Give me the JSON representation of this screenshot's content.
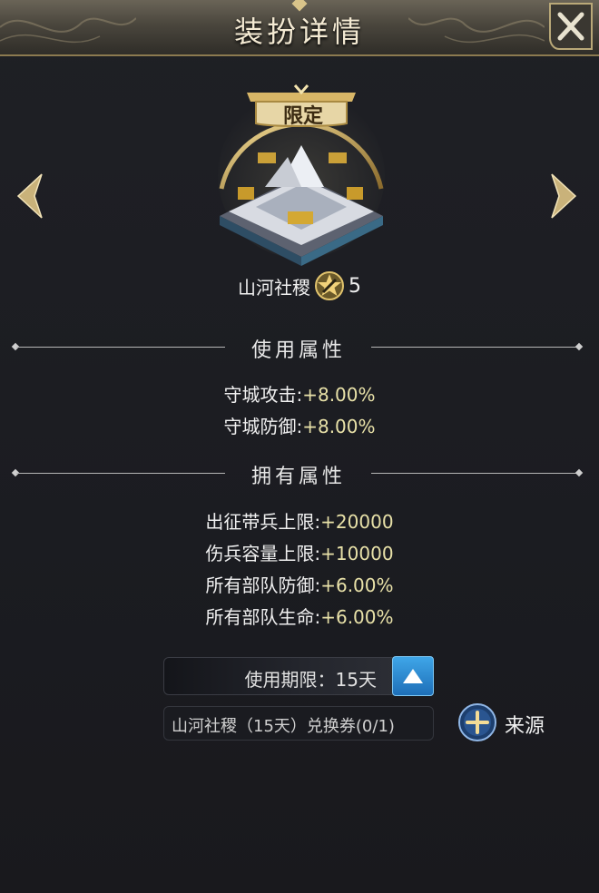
{
  "window": {
    "title": "装扮详情"
  },
  "skin": {
    "badge": "限定",
    "name": "山河社稷",
    "level": "5"
  },
  "usage_section": {
    "title": "使用属性",
    "attributes": [
      {
        "label": "守城攻击:",
        "value": "+8.00%"
      },
      {
        "label": "守城防御:",
        "value": "+8.00%"
      }
    ]
  },
  "owned_section": {
    "title": "拥有属性",
    "attributes": [
      {
        "label": "出征带兵上限:",
        "value": "+20000"
      },
      {
        "label": "伤兵容量上限:",
        "value": "+10000"
      },
      {
        "label": "所有部队防御:",
        "value": "+6.00%"
      },
      {
        "label": "所有部队生命:",
        "value": "+6.00%"
      }
    ]
  },
  "duration": {
    "text": "使用期限：15天"
  },
  "coupon": {
    "text": "山河社稷（15天）兑换券(0/1)"
  },
  "source": {
    "label": "来源"
  },
  "icons": {
    "close": "close-icon",
    "prev": "chevron-left-icon",
    "next": "chevron-right-icon",
    "toggle": "triangle-up-icon",
    "source": "plus-icon",
    "star": "star-level-icon"
  },
  "colors": {
    "value_text": "#e8e1a8",
    "accent_gold": "#c9a860",
    "toggle_blue": "#2f8fd6"
  }
}
